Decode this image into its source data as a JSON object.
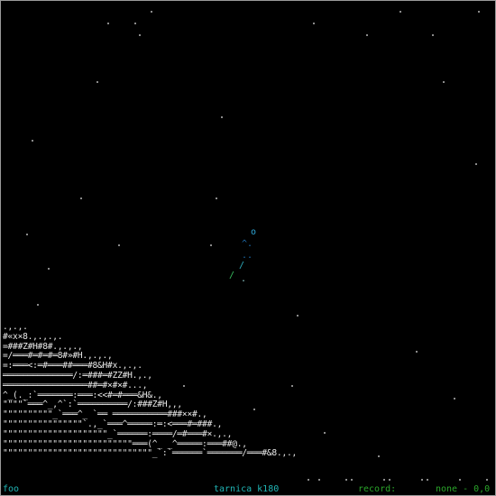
{
  "terrain_lines": [
    ".,.,.",
    "#«x×8.,.,.,.",
    "=###Z#H#8#.,.,.,",
    "=/═══#═#═#═8#»#H.,.,.,",
    "=:═══<:═#═══##═══#8&H#x.,.,.",
    "══════════════/:═###═#ZZ#H.,.,",
    "═════════════════##═#×#×#...,",
    "^_(._:`═══════:═══:<<#═#═══&H&.,",
    "\"\"\"\"`═══^_,^`:`══════════/:###Z#H,,,",
    "\"\"\"\"\"\"\"\"\"\"_`═══^_ `══ ═══════════###××#.,",
    "\"\"\"\"\"\"\"\"\"\"\"\"\"\"\"\"`.,_`═══^═════:═:<═══#═###.,",
    "\"\"\"\"\"\"\"\"\"\"\"\"\"\"\"\"\"\"\"\"\"_`══════:════/═#═══#×.,.,",
    "\"\"\"\"\"\"\"\"\"\"\"\"\"\"\"\"\"\"\"\"\"\"\"\"\"\"═══(^_ _^═════:═══##@.,",
    "\"\"\"\"\"\"\"\"\"\"\"\"\"\"\"\"\"\"\"\"\"\"\"\"\"\"\"\"\"\"_`:`══════`═══════/═══#&8.,.,"
  ],
  "sprites": [
    {
      "name": "ship-o-glyph",
      "text": "o",
      "color": "#2fa8d8"
    },
    {
      "name": "ship-trail-1",
      "text": "^.",
      "color": "#1f6fb0"
    },
    {
      "name": "ship-trail-2",
      "text": "..",
      "color": "#1f6fb0"
    },
    {
      "name": "ship-slash-1",
      "text": "/",
      "color": "#2fb0c0"
    },
    {
      "name": "ship-dot",
      "text": ".",
      "color": "#9adada"
    },
    {
      "name": "ship-slash-2",
      "text": "/",
      "color": "#38c060"
    }
  ],
  "status": {
    "left": "foo",
    "center": "tarnica k180",
    "record": "record:",
    "mode": "none - 0,0"
  },
  "colors": {
    "background": "#000000",
    "stars": "#8a8a8a",
    "terrain": "#e8e8e8",
    "status_cyan": "#20b5b5",
    "status_green": "#2aa52a"
  }
}
